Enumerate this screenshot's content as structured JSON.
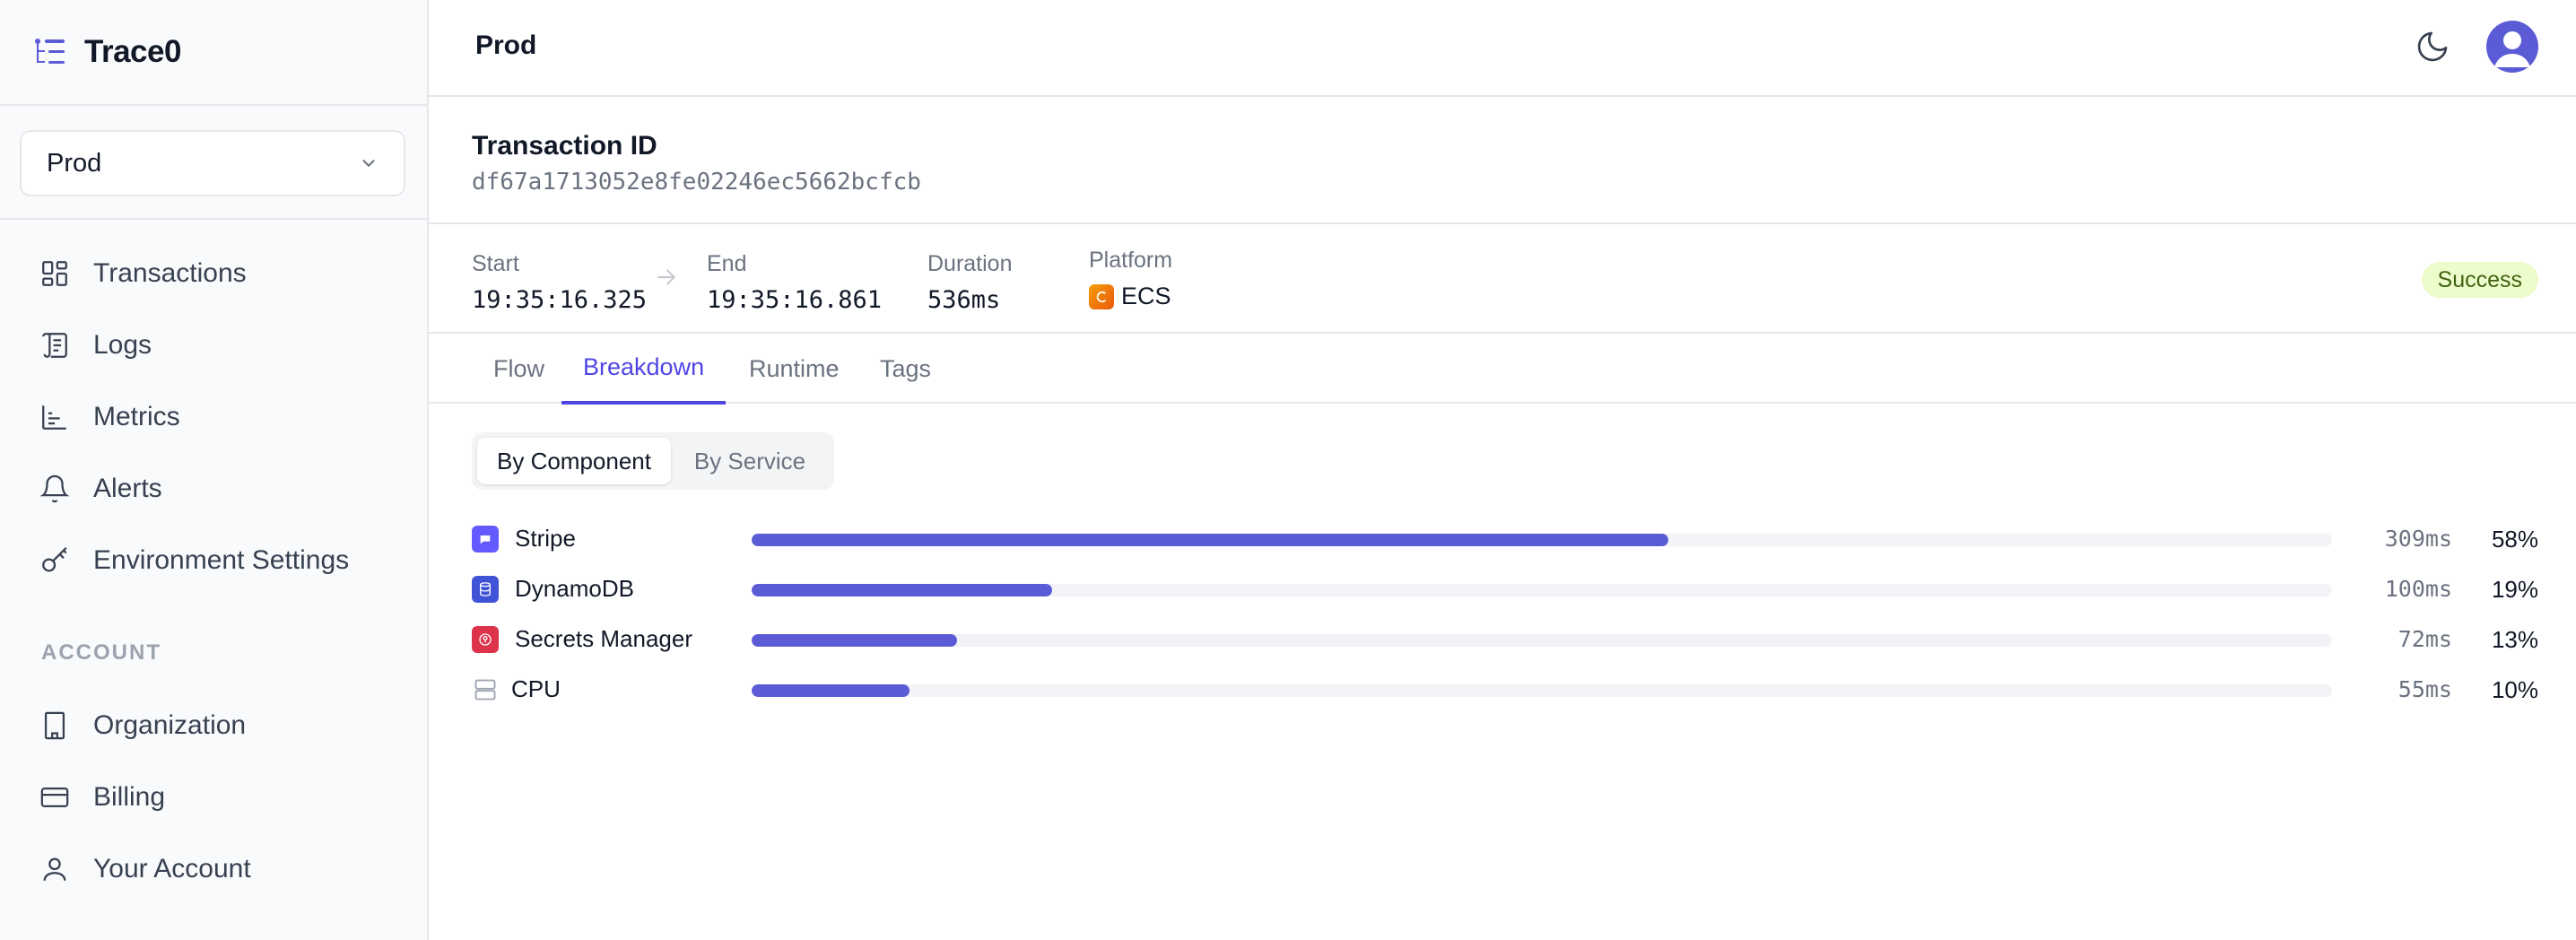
{
  "app": {
    "name": "Trace0"
  },
  "environment": {
    "selected": "Prod"
  },
  "sidebar": {
    "nav": [
      {
        "label": "Transactions",
        "icon": "grid-icon"
      },
      {
        "label": "Logs",
        "icon": "scroll-icon"
      },
      {
        "label": "Metrics",
        "icon": "bar-chart-icon"
      },
      {
        "label": "Alerts",
        "icon": "bell-icon"
      },
      {
        "label": "Environment Settings",
        "icon": "key-icon"
      }
    ],
    "account_title": "ACCOUNT",
    "account": [
      {
        "label": "Organization",
        "icon": "building-icon"
      },
      {
        "label": "Billing",
        "icon": "credit-card-icon"
      },
      {
        "label": "Your Account",
        "icon": "user-icon"
      }
    ]
  },
  "topbar": {
    "title": "Prod"
  },
  "transaction": {
    "title": "Transaction ID",
    "id": "df67a1713052e8fe02246ec5662bcfcb",
    "start_label": "Start",
    "start": "19:35:16.325",
    "end_label": "End",
    "end": "19:35:16.861",
    "duration_label": "Duration",
    "duration": "536ms",
    "platform_label": "Platform",
    "platform": "ECS",
    "status": "Success"
  },
  "tabs": [
    {
      "label": "Flow",
      "active": false
    },
    {
      "label": "Breakdown",
      "active": true
    },
    {
      "label": "Runtime",
      "active": false
    },
    {
      "label": "Tags",
      "active": false
    }
  ],
  "breakdown": {
    "modes": [
      "By Component",
      "By Service"
    ],
    "active_mode": "By Component",
    "rows": [
      {
        "name": "Stripe",
        "ms": "309ms",
        "pct": "58%",
        "fraction": 0.58,
        "icon": "stripe-icon",
        "color": "#635bff"
      },
      {
        "name": "DynamoDB",
        "ms": "100ms",
        "pct": "19%",
        "fraction": 0.19,
        "icon": "dynamodb-icon",
        "color": "#4053d6"
      },
      {
        "name": "Secrets Manager",
        "ms": "72ms",
        "pct": "13%",
        "fraction": 0.13,
        "icon": "secrets-manager-icon",
        "color": "#dd344c"
      },
      {
        "name": "CPU",
        "ms": "55ms",
        "pct": "10%",
        "fraction": 0.1,
        "icon": "server-icon",
        "color": "#9ca3af"
      }
    ]
  },
  "colors": {
    "accent": "#5b5bd6",
    "success_bg": "#ecfccb",
    "success_text": "#3f6212"
  }
}
